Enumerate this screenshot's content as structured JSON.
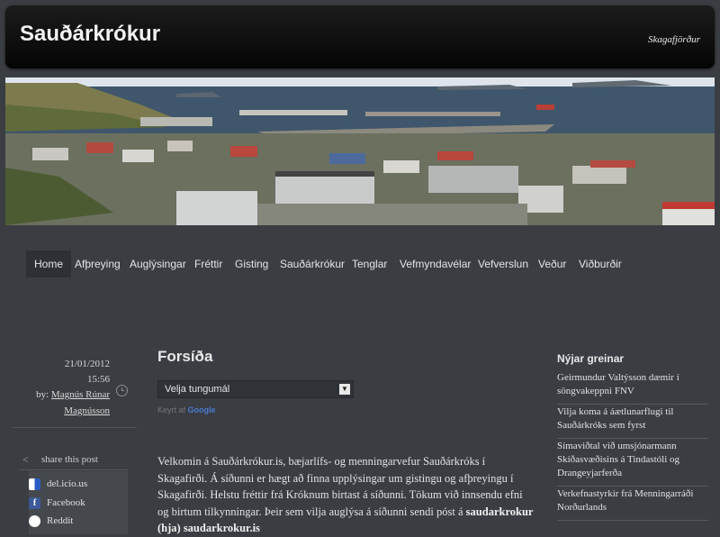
{
  "header": {
    "title": "Sauðárkrókur",
    "tagline": "Skagafjörður"
  },
  "nav": {
    "items": [
      "Home",
      "Afþreying",
      "Auglýsingar",
      "Fréttir",
      "Gisting",
      "Sauðárkrókur",
      "Tenglar",
      "Vefmyndavélar",
      "Vefverslun",
      "Veður",
      "Viðburðir"
    ],
    "active": "Home"
  },
  "post_meta": {
    "date": "21/01/2012",
    "time": "15:56",
    "by_label": "by:",
    "author_line1": "Magnús Rúnar",
    "author_line2": "Magnússon"
  },
  "share": {
    "heading": "share this post",
    "items": [
      "del.icio.us",
      "Facebook",
      "Reddit"
    ]
  },
  "main": {
    "title": "Forsíða",
    "language_select": "Velja tungumál",
    "powered_label": "Keyrt af",
    "powered_brand": "Google",
    "body_p1": "Velkomin á Sauðárkrókur.is, bæjarlífs- og menningarvefur Sauðárkróks í Skagafirði. Á síðunni er hægt að finna upplýsingar um gistingu og afþreyingu í Skagafirði.  Helstu fréttir frá Króknum birtast á síðunni. Tökum við innsendu efni og birtum tilkynningar.  Þeir sem vilja auglýsa á síðunni sendi póst á",
    "body_email": "saudarkrokur (hja) saudarkrokur.is"
  },
  "sidebar": {
    "heading": "Nýjar greinar",
    "items": [
      "Geirmundur Valtýsson dæmir í söngvakeppni FNV",
      "Vilja koma á áætlunarflugi til Sauðárkróks sem fyrst",
      "Símaviðtal við umsjónarmann Skíðasvæðisins á Tindastóli og Drangeyjarferða",
      "Verkefnastyrkir frá Menningarráði Norðurlands"
    ]
  },
  "colors": {
    "background": "#3a3d42",
    "header": "#0a0a0a",
    "accent": "#e8e8e8"
  }
}
